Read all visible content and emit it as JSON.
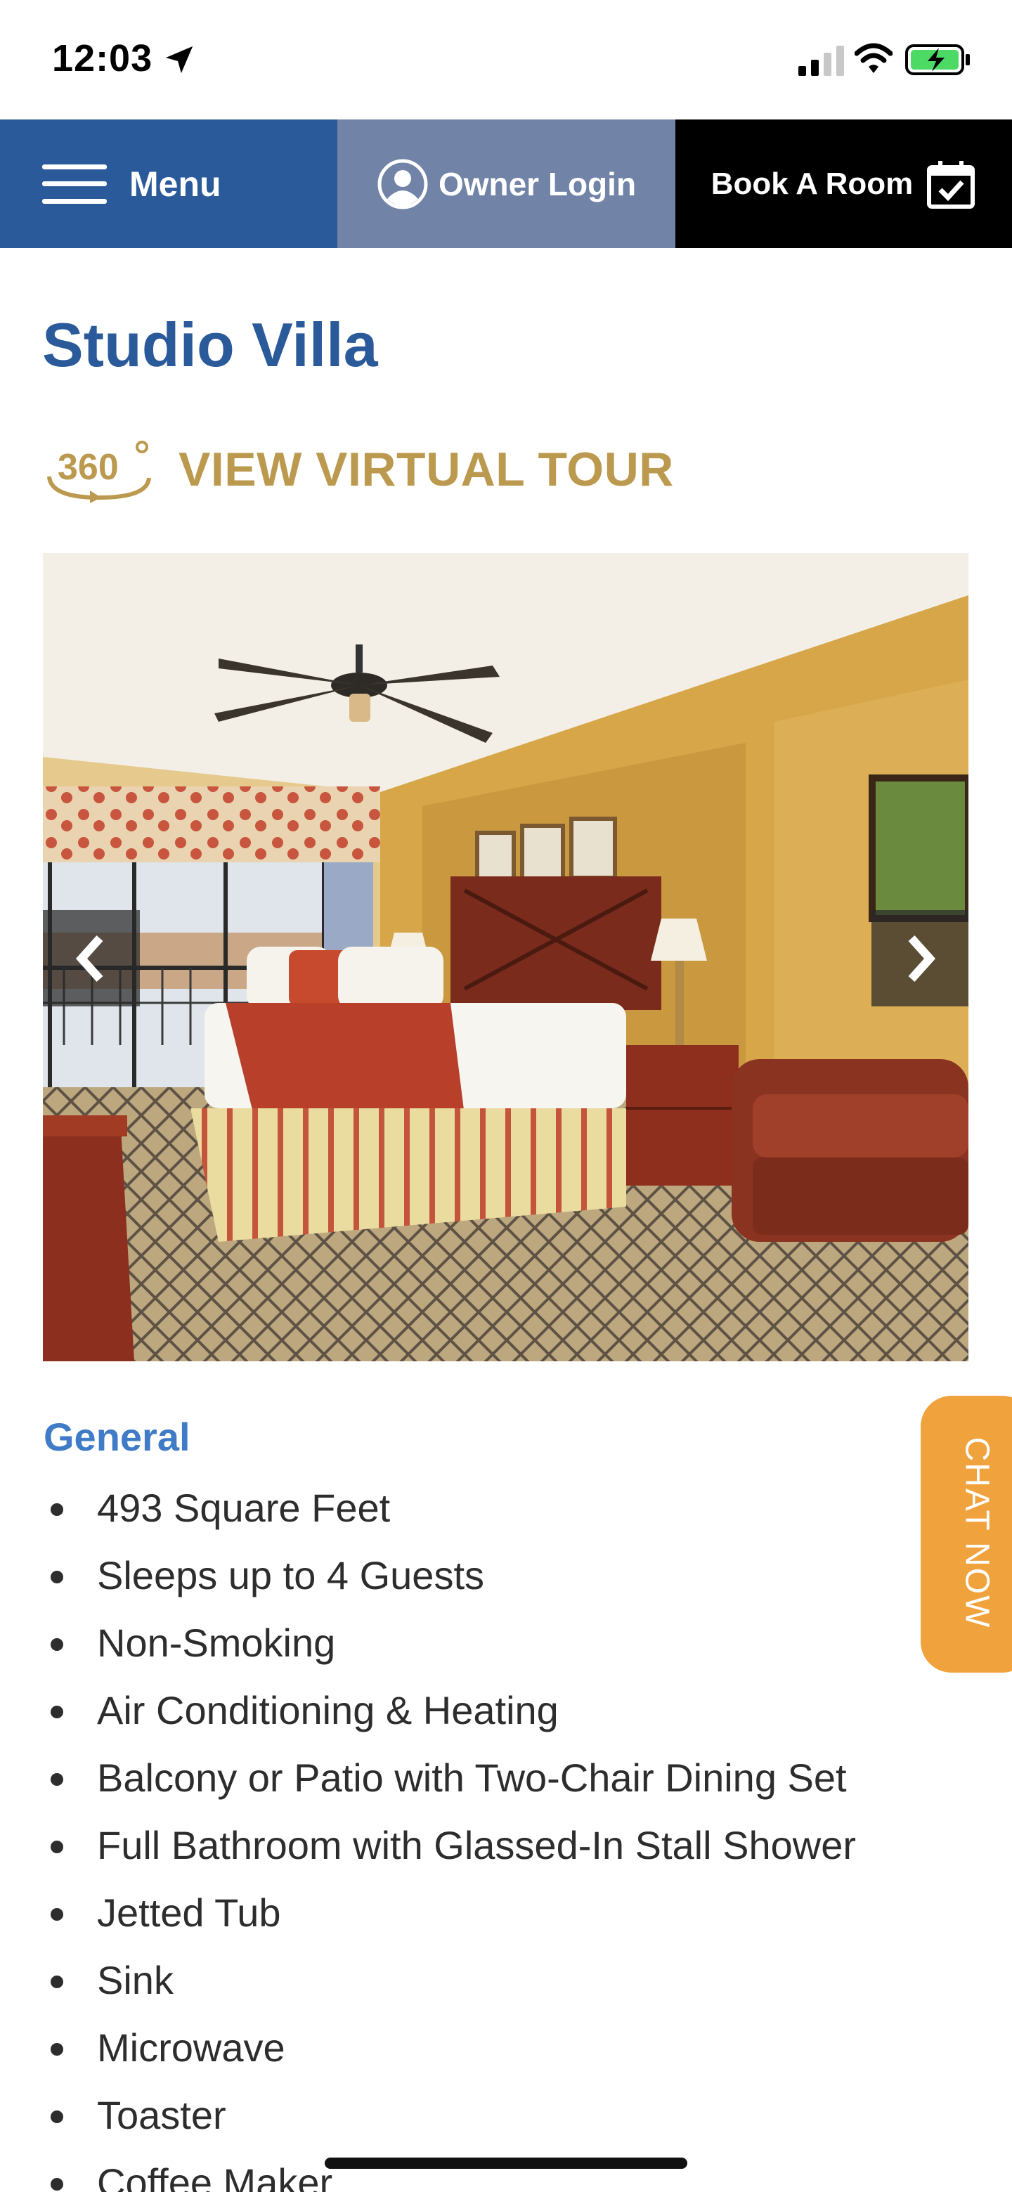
{
  "status_bar": {
    "time": "12:03",
    "icons": [
      "location-arrow-icon",
      "cellular-signal-icon",
      "wifi-icon",
      "battery-charging-icon"
    ]
  },
  "nav": {
    "menu_label": "Menu",
    "owner_login_label": "Owner Login",
    "book_room_label": "Book A Room",
    "colors": {
      "menu_bg": "#2a5a99",
      "owner_bg": "#7183a6",
      "book_bg": "#000000"
    }
  },
  "page": {
    "title": "Studio Villa",
    "virtual_tour": {
      "icon": "360-icon",
      "label": "VIEW VIRTUAL TOUR"
    }
  },
  "carousel": {
    "image": "hotel-room-photo",
    "prev_icon": "chevron-left-icon",
    "next_icon": "chevron-right-icon"
  },
  "general": {
    "heading": "General",
    "items": [
      "493 Square Feet",
      "Sleeps up to 4 Guests",
      "Non-Smoking",
      "Air Conditioning & Heating",
      "Balcony or Patio with Two-Chair Dining Set",
      "Full Bathroom with Glassed-In Stall Shower",
      "Jetted Tub",
      "Sink",
      "Microwave",
      "Toaster",
      "Coffee Maker"
    ]
  },
  "chat": {
    "label": "CHAT NOW",
    "color": "#f0a23c"
  },
  "colors": {
    "brand_blue": "#2a5a99",
    "gold": "#bb9a4f",
    "heading_blue": "#3f7bc6"
  }
}
